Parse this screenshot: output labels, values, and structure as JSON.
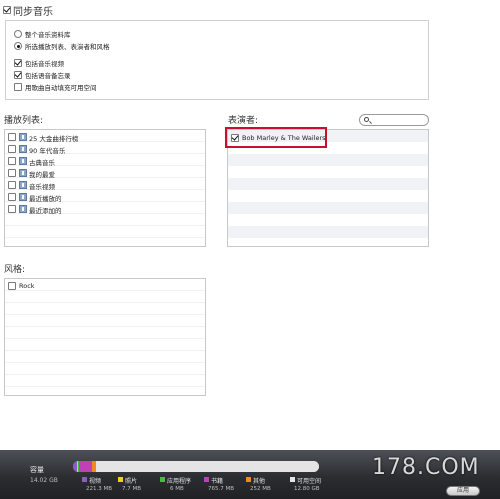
{
  "sync": {
    "label": "同步音乐",
    "checked": true,
    "options": [
      {
        "label": "整个音乐资料库",
        "selected": false
      },
      {
        "label": "所选播放列表、表演者和风格",
        "selected": true
      }
    ],
    "checkboxes": [
      {
        "label": "包括音乐视频",
        "checked": true
      },
      {
        "label": "包括语音备忘录",
        "checked": true
      },
      {
        "label": "用歌曲自动填充可用空间",
        "checked": false
      }
    ]
  },
  "playlists": {
    "heading": "播放列表:",
    "items": [
      {
        "label": "25 大金曲排行榜",
        "checked": false
      },
      {
        "label": "90 年代音乐",
        "checked": false
      },
      {
        "label": "古典音乐",
        "checked": false
      },
      {
        "label": "我的最爱",
        "checked": false
      },
      {
        "label": "音乐视频",
        "checked": false
      },
      {
        "label": "最近播放的",
        "checked": false
      },
      {
        "label": "最近添加的",
        "checked": false
      }
    ]
  },
  "artists": {
    "heading": "表演者:",
    "search_placeholder": "",
    "items": [
      {
        "label": "Bob Marley & The Wailers",
        "checked": true
      }
    ]
  },
  "genres": {
    "heading": "风格:",
    "items": [
      {
        "label": "Rock",
        "checked": false
      }
    ]
  },
  "capacity": {
    "label": "容量",
    "total": "14.02 GB",
    "segments": [
      {
        "name": "视频",
        "size": "221.3 MB",
        "color": "#8a5cc9",
        "fraction": 0.016
      },
      {
        "name": "照片",
        "size": "7.7 MB",
        "color": "#f0d21e",
        "fraction": 0.006
      },
      {
        "name": "应用程序",
        "size": "6 MB",
        "color": "#3ec23e",
        "fraction": 0.006
      },
      {
        "name": "书籍",
        "size": "765.7 MB",
        "color": "#c040b8",
        "fraction": 0.054
      },
      {
        "name": "其他",
        "size": "252 MB",
        "color": "#f08a1c",
        "fraction": 0.018
      },
      {
        "name": "可用空间",
        "size": "12.80 GB",
        "color": "#e4e4e4",
        "fraction": 0.9
      }
    ]
  },
  "apply_button": "应用",
  "watermark": "178.COM"
}
